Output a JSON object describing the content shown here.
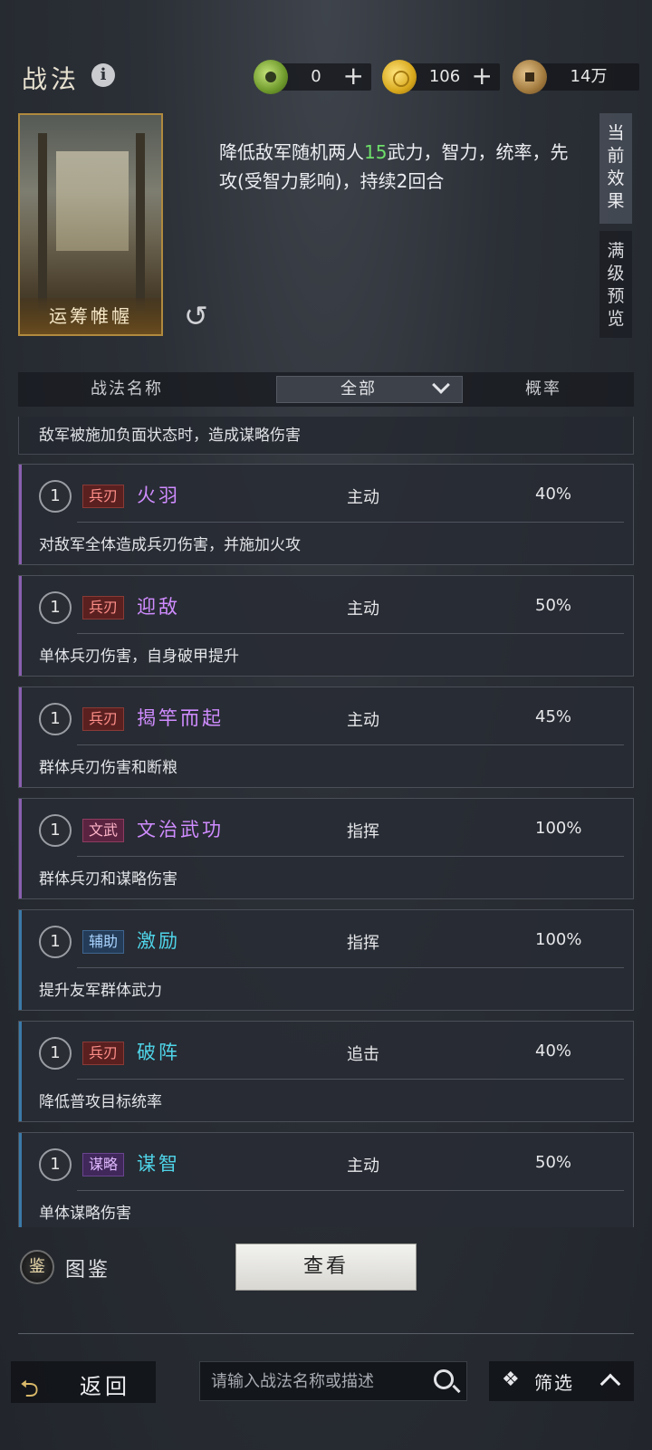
{
  "header": {
    "title": "战法",
    "resources": [
      {
        "icon": "jade-coin-icon",
        "value": "0"
      },
      {
        "icon": "gold-coin-icon",
        "value": "106"
      },
      {
        "icon": "copper-coin-icon",
        "value": "14万"
      }
    ],
    "plus": "+"
  },
  "card": {
    "name": "运筹帷幄",
    "effect_prefix": "降低敌军随机两人",
    "effect_highlight": "15",
    "effect_suffix": "武力，智力，统率，先攻(受智力影响)，持续2回合",
    "highlight_color": "#6ee06a"
  },
  "side_tabs": {
    "current": "当前效果",
    "max_preview": "满级预览"
  },
  "table_header": {
    "name": "战法名称",
    "filter_selected": "全部",
    "rate": "概率"
  },
  "partial_item": {
    "desc": "敌军被施加负面状态时，造成谋略伤害"
  },
  "items": [
    {
      "level": "1",
      "tag": "兵刃",
      "name": "火羽",
      "type": "主动",
      "rate": "40%",
      "desc": "对敌军全体造成兵刃伤害，并施加火攻"
    },
    {
      "level": "1",
      "tag": "兵刃",
      "name": "迎敌",
      "type": "主动",
      "rate": "50%",
      "desc": "单体兵刃伤害，自身破甲提升"
    },
    {
      "level": "1",
      "tag": "兵刃",
      "name": "揭竿而起",
      "type": "主动",
      "rate": "45%",
      "desc": "群体兵刃伤害和断粮"
    },
    {
      "level": "1",
      "tag": "文武",
      "name": "文治武功",
      "type": "指挥",
      "rate": "100%",
      "desc": "群体兵刃和谋略伤害"
    },
    {
      "level": "1",
      "tag": "辅助",
      "name": "激励",
      "type": "指挥",
      "rate": "100%",
      "desc": "提升友军群体武力"
    },
    {
      "level": "1",
      "tag": "兵刃",
      "name": "破阵",
      "type": "追击",
      "rate": "40%",
      "desc": "降低普攻目标统率"
    },
    {
      "level": "1",
      "tag": "谋略",
      "name": "谋智",
      "type": "主动",
      "rate": "50%",
      "desc": "单体谋略伤害"
    }
  ],
  "bottom": {
    "atlas_icon_char": "鉴",
    "atlas_label": "图鉴",
    "view_button": "查看",
    "back_label": "返回",
    "search_placeholder": "请输入战法名称或描述",
    "filter_label": "筛选"
  }
}
